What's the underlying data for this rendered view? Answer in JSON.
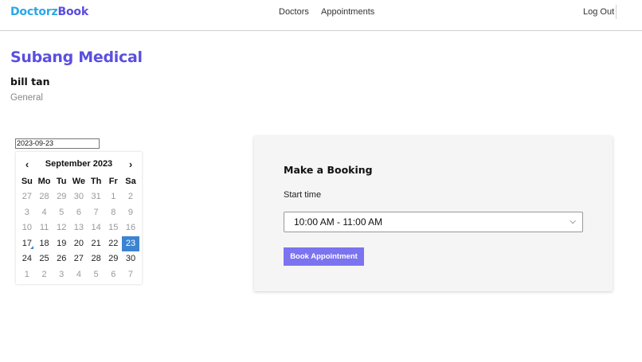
{
  "navbar": {
    "logo_part1": "Doctorz",
    "logo_part2": "Book",
    "links": [
      "Doctors",
      "Appointments"
    ],
    "logout_label": "Log Out"
  },
  "clinic": {
    "name": "Subang Medical",
    "doctor_name": "bill tan",
    "specialty": "General"
  },
  "date_picker": {
    "value": "2023-09-23",
    "month_title": "September 2023",
    "prev_label": "‹",
    "next_label": "›",
    "weekdays": [
      "Su",
      "Mo",
      "Tu",
      "We",
      "Th",
      "Fr",
      "Sa"
    ],
    "weeks": [
      [
        "27",
        "28",
        "29",
        "30",
        "31",
        "1",
        "2"
      ],
      [
        "3",
        "4",
        "5",
        "6",
        "7",
        "8",
        "9"
      ],
      [
        "10",
        "11",
        "12",
        "13",
        "14",
        "15",
        "16"
      ],
      [
        "17",
        "18",
        "19",
        "20",
        "21",
        "22",
        "23"
      ],
      [
        "24",
        "25",
        "26",
        "27",
        "28",
        "29",
        "30"
      ],
      [
        "1",
        "2",
        "3",
        "4",
        "5",
        "6",
        "7"
      ]
    ],
    "selected_day": "23",
    "today_day": "17",
    "selected_color": "#3c83d2"
  },
  "booking": {
    "title": "Make a Booking",
    "start_time_label": "Start time",
    "selected_time": "10:00 AM - 11:00 AM",
    "button_label": "Book Appointment",
    "button_color": "#7b73f0"
  },
  "icons": {
    "dropdown": "chevron-down-icon"
  }
}
